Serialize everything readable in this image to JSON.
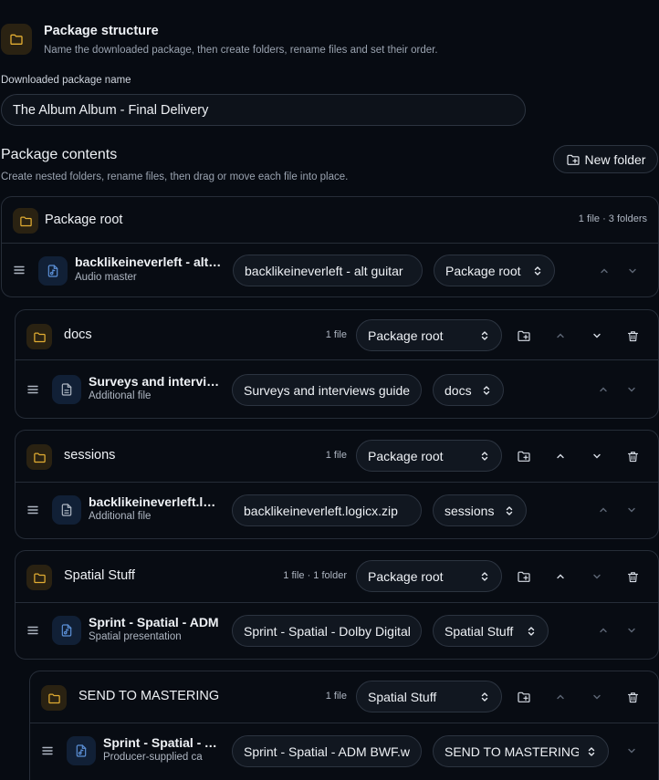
{
  "header": {
    "title": "Package structure",
    "subtitle": "Name the downloaded package, then create folders, rename files and set their order."
  },
  "package_name": {
    "label": "Downloaded package name",
    "value": "The Album Album - Final Delivery"
  },
  "contents": {
    "title": "Package contents",
    "subtitle": "Create nested folders, rename files, then drag or move each file into place.",
    "new_folder_label": "New folder"
  },
  "colors": {
    "background": "#070b12",
    "folder_accent": "#e2ad32",
    "file_accent": "#5b8fd6",
    "border": "#262d38"
  },
  "root": {
    "name": "Package root",
    "count": "1 file · 3 folders",
    "file": {
      "name": "backlikeineverleft - alt guitar",
      "type": "Audio master",
      "rename_value": "backlikeineverleft - alt guitar",
      "folder": "Package root"
    }
  },
  "folders": [
    {
      "name": "docs",
      "count": "1 file",
      "parent": "Package root",
      "file": {
        "name": "Surveys and interviews guide",
        "type": "Additional file",
        "rename_value": "Surveys and interviews guide",
        "folder": "docs"
      }
    },
    {
      "name": "sessions",
      "count": "1 file",
      "parent": "Package root",
      "file": {
        "name": "backlikeineverleft.logicx.zip",
        "type": "Additional file",
        "rename_value": "backlikeineverleft.logicx.zip",
        "folder": "sessions"
      }
    },
    {
      "name": "Spatial Stuff",
      "count": "1 file · 1 folder",
      "parent": "Package root",
      "file": {
        "name": "Sprint - Spatial - ADM",
        "type": "Spatial presentation",
        "rename_value": "Sprint - Spatial - Dolby Digital",
        "folder": "Spatial Stuff"
      }
    },
    {
      "name": "SEND TO MASTERING",
      "count": "1 file",
      "parent": "Spatial Stuff",
      "file": {
        "name": "Sprint - Spatial - ADM",
        "type": "Producer-supplied ca",
        "rename_value": "Sprint - Spatial - ADM BWF.wav",
        "folder": "SEND TO MASTERING"
      }
    }
  ]
}
